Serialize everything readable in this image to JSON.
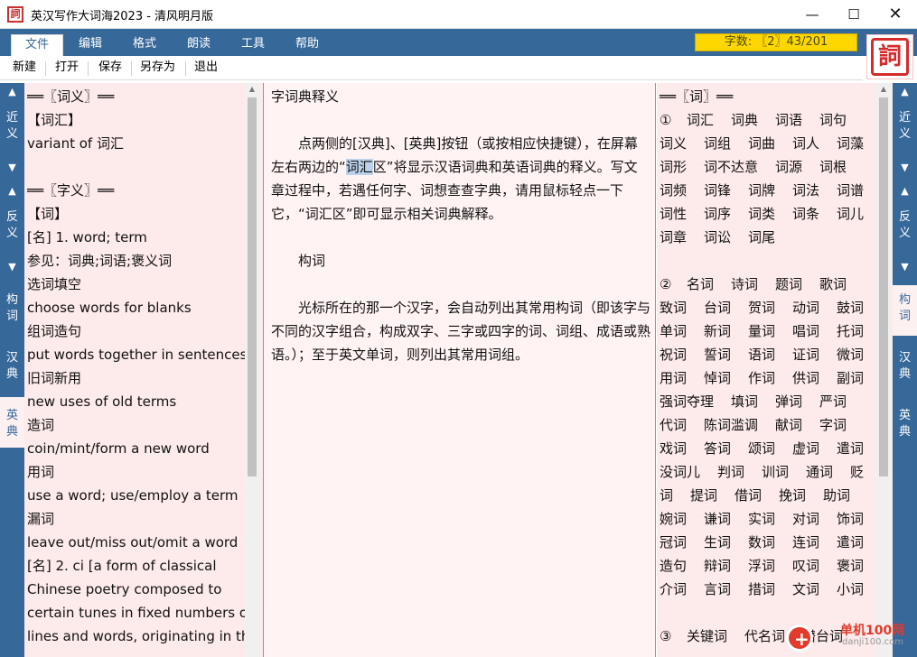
{
  "window": {
    "title": "英汉写作大词海2023 - 清风明月版",
    "icon_label": "詞",
    "minimize": "—",
    "maximize": "☐",
    "close": "✕"
  },
  "menu": {
    "items": [
      "文件",
      "编辑",
      "格式",
      "朗读",
      "工具",
      "帮助"
    ],
    "active": "文件",
    "counter": "字数: 〖2〗43/201"
  },
  "logo": {
    "glyph": "詞"
  },
  "toolbar": {
    "buttons": [
      "新建",
      "打开",
      "保存",
      "另存为",
      "退出"
    ]
  },
  "left_rail": {
    "up1": "▲",
    "label1": "近义",
    "down1": "▼",
    "up2": "▲",
    "label2": "反义",
    "down2": "▼",
    "label3": "构词",
    "label4": "汉典",
    "label5": "英典"
  },
  "right_rail": {
    "up1": "▲",
    "label1": "近义",
    "down1": "▼",
    "up2": "▲",
    "label2": "反义",
    "down2": "▼",
    "label3": "构词",
    "label4": "汉典",
    "label5": "英典"
  },
  "left_panel": {
    "lines": [
      "══〖词义〗══",
      "【词汇】",
      "variant of 词汇",
      "",
      "══〖字义〗══",
      "【词】",
      "[名] 1. word; term",
      "参见：词典;词语;褒义词",
      "选词填空",
      "choose words for blanks",
      "组词造句",
      "put words together in sentences",
      "旧词新用",
      "new uses of old terms",
      "造词",
      "coin/mint/form a new word",
      "用词",
      "use a word; use/employ a term",
      "漏词",
      "leave out/miss out/omit a word",
      "[名] 2. ci   [a form of classical",
      "Chinese poetry composed to",
      "certain tunes in fixed numbers of",
      "lines and words, originating in the"
    ]
  },
  "center_panel": {
    "title": "字词典释义",
    "para1_before": "　　点两侧的[汉典]、[英典]按钮（或按相应快捷键），在屏幕左右两边的“",
    "para1_highlight": "词汇",
    "para1_after": "区”将显示汉语词典和英语词典的释义。写文章过程中，若遇任何字、词想查查字典，请用鼠标轻点一下它，“词汇区”即可显示相关词典解释。",
    "heading2": "　　构词",
    "para2": "　　光标所在的那一个汉字，会自动列出其常用构词（即该字与不同的汉字组合，构成双字、三字或四字的词、词组、成语或熟语。）；至于英文单词，则列出其常用词组。"
  },
  "right_panel": {
    "header": "══〖词〗══",
    "section1_label": "①",
    "section1_rows": [
      [
        "词汇",
        "词典",
        "词语",
        "词句"
      ],
      [
        "词义",
        "词组",
        "词曲",
        "词人",
        "词藻"
      ],
      [
        "词形",
        "词不达意",
        "词源",
        "词根"
      ],
      [
        "词频",
        "词锋",
        "词牌",
        "词法",
        "词谱"
      ],
      [
        "词性",
        "词序",
        "词类",
        "词条",
        "词儿"
      ],
      [
        "词章",
        "词讼",
        "词尾"
      ]
    ],
    "section2_label": "②",
    "section2_rows": [
      [
        "名词",
        "诗词",
        "题词",
        "歌词"
      ],
      [
        "致词",
        "台词",
        "贺词",
        "动词",
        "鼓词"
      ],
      [
        "单词",
        "新词",
        "量词",
        "唱词",
        "托词"
      ],
      [
        "祝词",
        "誓词",
        "语词",
        "证词",
        "微词"
      ],
      [
        "用词",
        "悼词",
        "作词",
        "供词",
        "副词"
      ],
      [
        "强词夺理",
        "填词",
        "弹词",
        "严词"
      ],
      [
        "代词",
        "陈词滥调",
        "献词",
        "字词"
      ],
      [
        "戏词",
        "答词",
        "颂词",
        "虚词",
        "遣词"
      ],
      [
        "没词儿",
        "判词",
        "训词",
        "通词",
        "贬"
      ],
      [
        "词",
        "提词",
        "借词",
        "挽词",
        "助词"
      ],
      [
        "婉词",
        "谦词",
        "实词",
        "对词",
        "饰词"
      ],
      [
        "冠词",
        "生词",
        "数词",
        "连词",
        "遣词"
      ],
      [
        "造句",
        "辩词",
        "浮词",
        "叹词",
        "褒词"
      ],
      [
        "介词",
        "言词",
        "措词",
        "文词",
        "小词"
      ]
    ],
    "section3_label": "③",
    "section3_rows": [
      [
        "关键词",
        "代名词",
        "潜台词"
      ]
    ]
  },
  "watermark": {
    "site": "单机100网",
    "url": "danji100.com",
    "glyph": "+"
  }
}
